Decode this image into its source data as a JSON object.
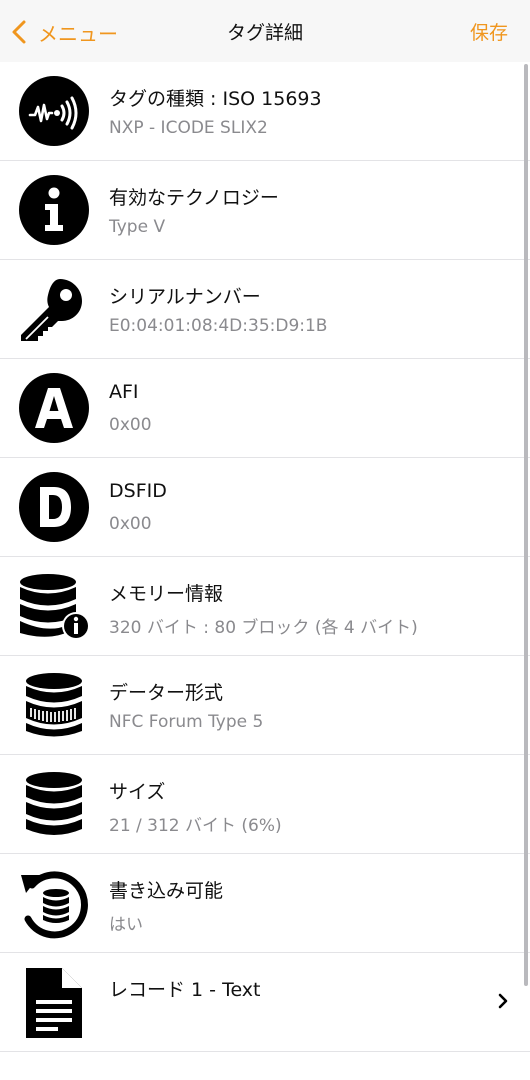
{
  "navbar": {
    "back_label": "メニュー",
    "title": "タグ詳細",
    "save_label": "保存"
  },
  "rows": [
    {
      "icon": "nfc-signal-icon",
      "title": "タグの種類 : ISO 15693",
      "value": "NXP - ICODE SLIX2"
    },
    {
      "icon": "info-icon",
      "title": "有効なテクノロジー",
      "value": "Type V"
    },
    {
      "icon": "key-icon",
      "title": "シリアルナンバー",
      "value": "E0:04:01:08:4D:35:D9:1B"
    },
    {
      "icon": "letter-a-icon",
      "title": "AFI",
      "value": "0x00"
    },
    {
      "icon": "letter-d-icon",
      "title": "DSFID",
      "value": "0x00"
    },
    {
      "icon": "database-info-icon",
      "title": "メモリー情報",
      "value": "320 バイト : 80 ブロック (各 4 バイト)"
    },
    {
      "icon": "database-format-icon",
      "title": "データー形式",
      "value": "NFC Forum Type 5"
    },
    {
      "icon": "database-icon",
      "title": "サイズ",
      "value": "21 / 312 バイト (6%)"
    },
    {
      "icon": "database-rewrite-icon",
      "title": "書き込み可能",
      "value": "はい"
    },
    {
      "icon": "document-icon",
      "title": "レコード 1 - Text",
      "value": ""
    }
  ],
  "colors": {
    "accent": "#f0961e",
    "secondary_text": "#8a8a8e",
    "separator": "#e3e3e6",
    "navbar_bg": "#f7f7f7"
  }
}
